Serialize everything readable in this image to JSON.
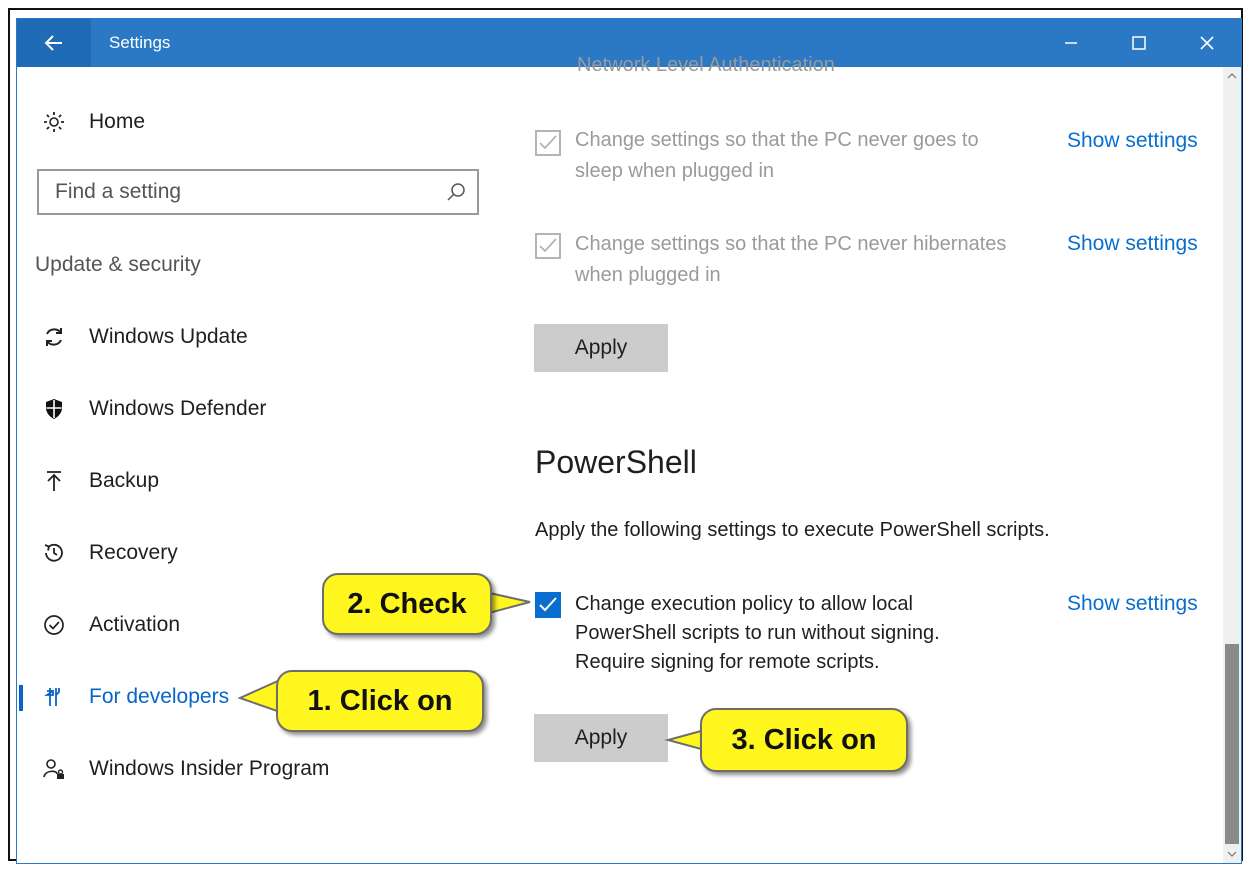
{
  "window": {
    "title": "Settings",
    "back_icon": "arrow-left-icon",
    "controls": [
      "minimize-icon",
      "maximize-icon",
      "close-icon"
    ]
  },
  "sidebar": {
    "home_label": "Home",
    "search": {
      "placeholder": "Find a setting",
      "value": ""
    },
    "section_title": "Update & security",
    "items": [
      {
        "label": "Windows Update",
        "icon": "sync-icon"
      },
      {
        "label": "Windows Defender",
        "icon": "shield-icon"
      },
      {
        "label": "Backup",
        "icon": "upload-icon"
      },
      {
        "label": "Recovery",
        "icon": "history-icon"
      },
      {
        "label": "Activation",
        "icon": "check-circle-icon"
      },
      {
        "label": "For developers",
        "icon": "developer-tools-icon",
        "selected": true
      },
      {
        "label": "Windows Insider Program",
        "icon": "insider-user-icon"
      }
    ],
    "accent_color": "#0a64c8"
  },
  "content": {
    "cut_off_text": "Network Level Authentication",
    "power_options": [
      {
        "text_line1": "Change settings so that the PC never goes to",
        "text_line2": "sleep when plugged in",
        "checked": true,
        "disabled": true,
        "link": "Show settings"
      },
      {
        "text_line1": "Change settings so that the PC never hibernates",
        "text_line2": "when plugged in",
        "checked": true,
        "disabled": true,
        "link": "Show settings"
      }
    ],
    "apply_label_1": "Apply",
    "powershell": {
      "heading": "PowerShell",
      "description": "Apply the following settings to execute PowerShell scripts.",
      "option": {
        "line1": "Change execution policy to allow local",
        "line2": "PowerShell scripts to run without signing.",
        "line3": "Require signing for remote scripts.",
        "checked": true,
        "link": "Show settings"
      },
      "apply_label": "Apply"
    }
  },
  "callouts": {
    "step1": "1. Click on",
    "step2": "2. Check",
    "step3": "3. Click on",
    "color": "#fff61e"
  }
}
